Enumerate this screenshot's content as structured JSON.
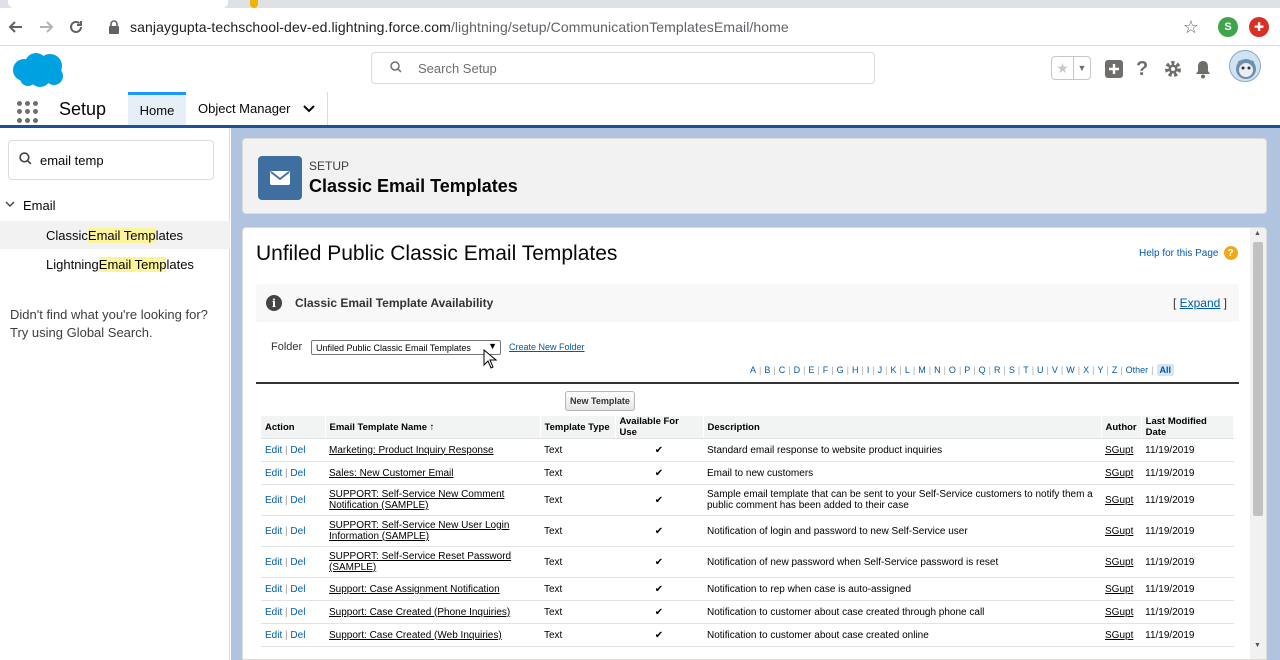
{
  "browser": {
    "url_host": "sanjaygupta-techschool-dev-ed.lightning.force.com",
    "url_path": "/lightning/setup/CommunicationTemplatesEmail/home",
    "ext_s": "S"
  },
  "header": {
    "search_placeholder": "Search Setup"
  },
  "context_bar": {
    "app_name": "Setup",
    "tab_home": "Home",
    "tab_object_manager": "Object Manager"
  },
  "sidebar": {
    "quick_find_value": "email temp",
    "group": "Email",
    "items": [
      {
        "pre": "Classic ",
        "hl": "Email Temp",
        "post": "lates"
      },
      {
        "pre": "Lightning ",
        "hl": "Email Temp",
        "post": "lates"
      }
    ],
    "not_found_line1": "Didn't find what you're looking for?",
    "not_found_line2": "Try using Global Search."
  },
  "page_header": {
    "eyebrow": "SETUP",
    "title": "Classic Email Templates"
  },
  "content": {
    "title": "Unfiled Public Classic Email Templates",
    "help_link": "Help for this Page",
    "availability_title": "Classic Email Template Availability",
    "expand_open": "[ ",
    "expand_label": "Expand",
    "expand_close": " ]",
    "folder_label": "Folder",
    "folder_value": "Unfiled Public Classic Email Templates",
    "create_folder": "Create New Folder",
    "alphabet": [
      "A",
      "B",
      "C",
      "D",
      "E",
      "F",
      "G",
      "H",
      "I",
      "J",
      "K",
      "L",
      "M",
      "N",
      "O",
      "P",
      "Q",
      "R",
      "S",
      "T",
      "U",
      "V",
      "W",
      "X",
      "Y",
      "Z",
      "Other"
    ],
    "alphabet_all": "All",
    "new_template_button": "New Template",
    "columns": [
      "Action",
      "Email Template Name",
      "Template Type",
      "Available For Use",
      "Description",
      "Author",
      "Last Modified Date"
    ],
    "sort_indicator": "↑",
    "rows": [
      {
        "edit": "Edit",
        "del": "Del",
        "name": "Marketing: Product Inquiry Response",
        "type": "Text",
        "available": "✔",
        "desc": "Standard email response to website product inquiries",
        "author": "SGupt",
        "date": "11/19/2019",
        "tall": false
      },
      {
        "edit": "Edit",
        "del": "Del",
        "name": "Sales: New Customer Email",
        "type": "Text",
        "available": "✔",
        "desc": "Email to new customers",
        "author": "SGupt",
        "date": "11/19/2019",
        "tall": false
      },
      {
        "edit": "Edit",
        "del": "Del",
        "name": "SUPPORT: Self-Service New Comment Notification (SAMPLE)",
        "type": "Text",
        "available": "✔",
        "desc": "Sample email template that can be sent to your Self-Service customers to notify them a public comment has been added to their case",
        "author": "SGupt",
        "date": "11/19/2019",
        "tall": true
      },
      {
        "edit": "Edit",
        "del": "Del",
        "name": "SUPPORT: Self-Service New User Login Information (SAMPLE)",
        "type": "Text",
        "available": "✔",
        "desc": "Notification of login and password to new Self-Service user",
        "author": "SGupt",
        "date": "11/19/2019",
        "tall": true
      },
      {
        "edit": "Edit",
        "del": "Del",
        "name": "SUPPORT: Self-Service Reset Password (SAMPLE)",
        "type": "Text",
        "available": "✔",
        "desc": "Notification of new password when Self-Service password is reset",
        "author": "SGupt",
        "date": "11/19/2019",
        "tall": true
      },
      {
        "edit": "Edit",
        "del": "Del",
        "name": "Support: Case Assignment Notification",
        "type": "Text",
        "available": "✔",
        "desc": "Notification to rep when case is auto-assigned",
        "author": "SGupt",
        "date": "11/19/2019",
        "tall": false
      },
      {
        "edit": "Edit",
        "del": "Del",
        "name": "Support: Case Created (Phone Inquiries)",
        "type": "Text",
        "available": "✔",
        "desc": "Notification to customer about case created through phone call",
        "author": "SGupt",
        "date": "11/19/2019",
        "tall": false
      },
      {
        "edit": "Edit",
        "del": "Del",
        "name": "Support: Case Created (Web Inquiries)",
        "type": "Text",
        "available": "✔",
        "desc": "Notification to customer about case created online",
        "author": "SGupt",
        "date": "11/19/2019",
        "tall": false
      }
    ]
  },
  "colors": {
    "brand_blue": "#00a1e0",
    "nav_blue": "#1b5297",
    "link": "#015ba7",
    "highlight": "#fbf49b"
  }
}
